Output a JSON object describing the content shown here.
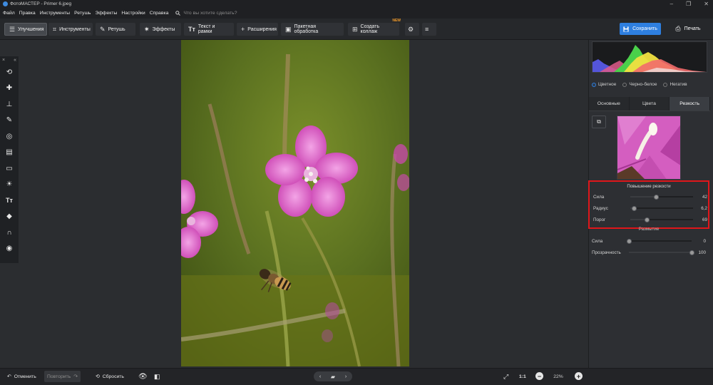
{
  "window": {
    "title": "ФотоМАСТЕР - Primer 6.jpeg",
    "controls": [
      "–",
      "❐",
      "✕"
    ]
  },
  "menu": {
    "items": [
      "Файл",
      "Правка",
      "Инструменты",
      "Ретушь",
      "Эффекты",
      "Настройки",
      "Справка"
    ],
    "search_placeholder": "Что вы хотите сделать?"
  },
  "toolbar": {
    "tabs": [
      {
        "label": "Улучшения",
        "icon": "sliders-icon"
      },
      {
        "label": "Инструменты",
        "icon": "crop-icon"
      },
      {
        "label": "Ретушь",
        "icon": "brush-icon"
      },
      {
        "label": "Эффекты",
        "icon": "sparkle-icon"
      },
      {
        "label": "Текст и рамки",
        "icon": "text-icon"
      },
      {
        "label": "Расширения",
        "icon": "plus-icon"
      },
      {
        "label": "Пакетная обработка",
        "icon": "batch-icon"
      },
      {
        "label": "Создать коллаж",
        "icon": "collage-icon"
      }
    ],
    "new_badge": "NEW",
    "save_label": "Сохранить",
    "print_label": "Печать"
  },
  "right_panel": {
    "modes": [
      "Цветное",
      "Черно-белое",
      "Негатив"
    ],
    "tabs": [
      "Основные",
      "Цвета",
      "Резкость"
    ],
    "active_tab": "Резкость",
    "sharpen": {
      "title": "Повышение резкости",
      "sliders": [
        {
          "label": "Сила",
          "value": "42",
          "fraction": 0.42
        },
        {
          "label": "Радиус",
          "value": "6,2",
          "fraction": 0.06
        },
        {
          "label": "Порог",
          "value": "69",
          "fraction": 0.27
        }
      ]
    },
    "blur": {
      "title": "Размытие",
      "sliders": [
        {
          "label": "Сила",
          "value": "0",
          "fraction": 0.0
        },
        {
          "label": "Прозрачность",
          "value": "100",
          "fraction": 1.0
        }
      ]
    }
  },
  "bottom": {
    "undo": "Отменить",
    "redo": "Повторить",
    "reset": "Сбросить",
    "ratio": "1:1",
    "zoom": "22%"
  }
}
